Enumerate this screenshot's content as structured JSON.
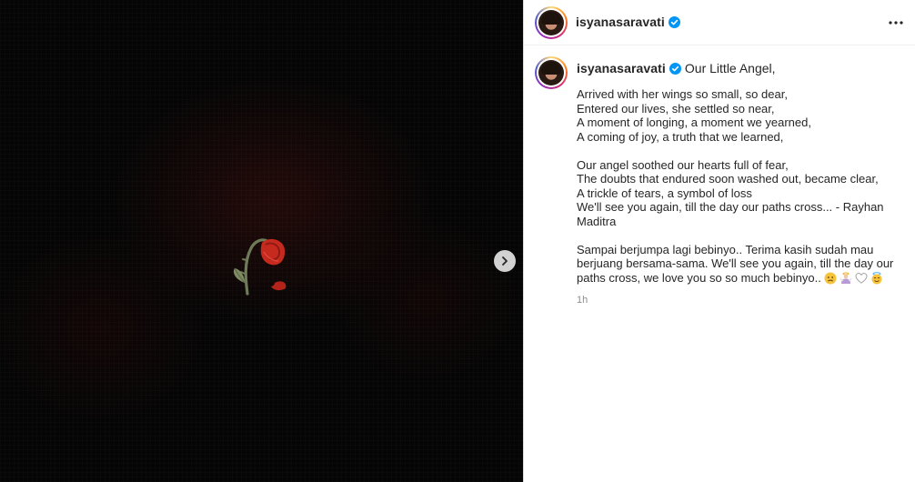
{
  "post": {
    "username": "isyanasaravati",
    "verified": true,
    "header_menu_icon": "more-horizontal-icon",
    "caption_title": "Our Little Angel,",
    "stanza1": [
      "Arrived with her wings so small, so dear,",
      "Entered our lives, she settled so near,",
      "A moment of longing, a moment we yearned,",
      "A coming of joy, a truth that we learned,"
    ],
    "stanza2": [
      "Our angel soothed our hearts full of fear,",
      "The doubts that endured soon washed out, became clear,",
      "A trickle of tears, a symbol of loss",
      "We'll see you again, till the day our paths cross... - Rayhan",
      "Maditra"
    ],
    "indonesian_text": "Sampai berjumpa lagi bebinyo.. Terima kasih sudah mau berjuang bersama-sama. We'll see you again, till the day our paths cross, we love you so so much bebinyo..",
    "emojis": [
      "sad-face-emoji",
      "praying-angel-emoji",
      "white-heart-emoji",
      "angel-face-emoji"
    ],
    "time_ago": "1h"
  },
  "media": {
    "image_subject": "wilted-red-rose-emoji",
    "next_icon": "chevron-right-icon"
  },
  "colors": {
    "verified_blue": "#0095f6",
    "text": "#262626",
    "muted": "#8e8e8e",
    "media_bg": "#050505",
    "rose_red": "#c62a1e"
  }
}
